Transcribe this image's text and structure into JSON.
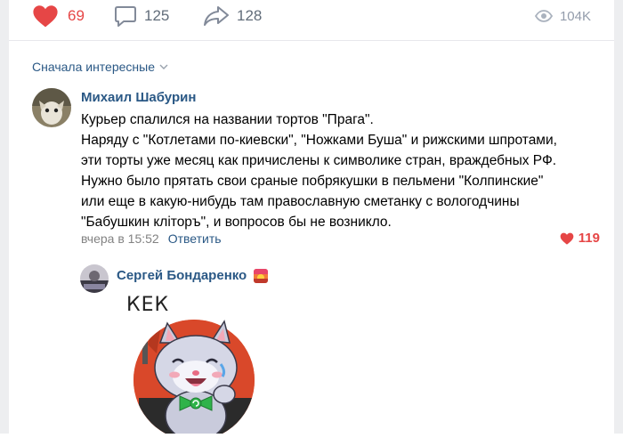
{
  "actions": {
    "likes": "69",
    "comments": "125",
    "shares": "128",
    "views": "104K"
  },
  "sort_label": "Сначала интересные",
  "comment": {
    "author": "Михаил Шабурин",
    "lines": [
      "Курьер спалился на названии тортов \"Прага\".",
      "Наряду с \"Котлетами по-киевски\", \"Ножками Буша\" и рижскими шпротами,",
      "эти торты уже месяц как причислены к символике стран, враждебных РФ.",
      "Нужно было прятать свои сраные побрякушки в пельмени \"Колпинские\"",
      "или еще в какую-нибудь там православную сметанку с вологодчины",
      "\"Бабушкин кліторъ\", и вопросов бы не возникло."
    ],
    "time": "вчера в 15:52",
    "reply_label": "Ответить",
    "likes": "119"
  },
  "reply_comment": {
    "author": "Сергей Бондаренко",
    "sticker_text": "КЕК"
  },
  "colors": {
    "like_red": "#e64646",
    "link_blue": "#2a5885",
    "muted": "#828282",
    "icon_gray": "#626d7a"
  }
}
